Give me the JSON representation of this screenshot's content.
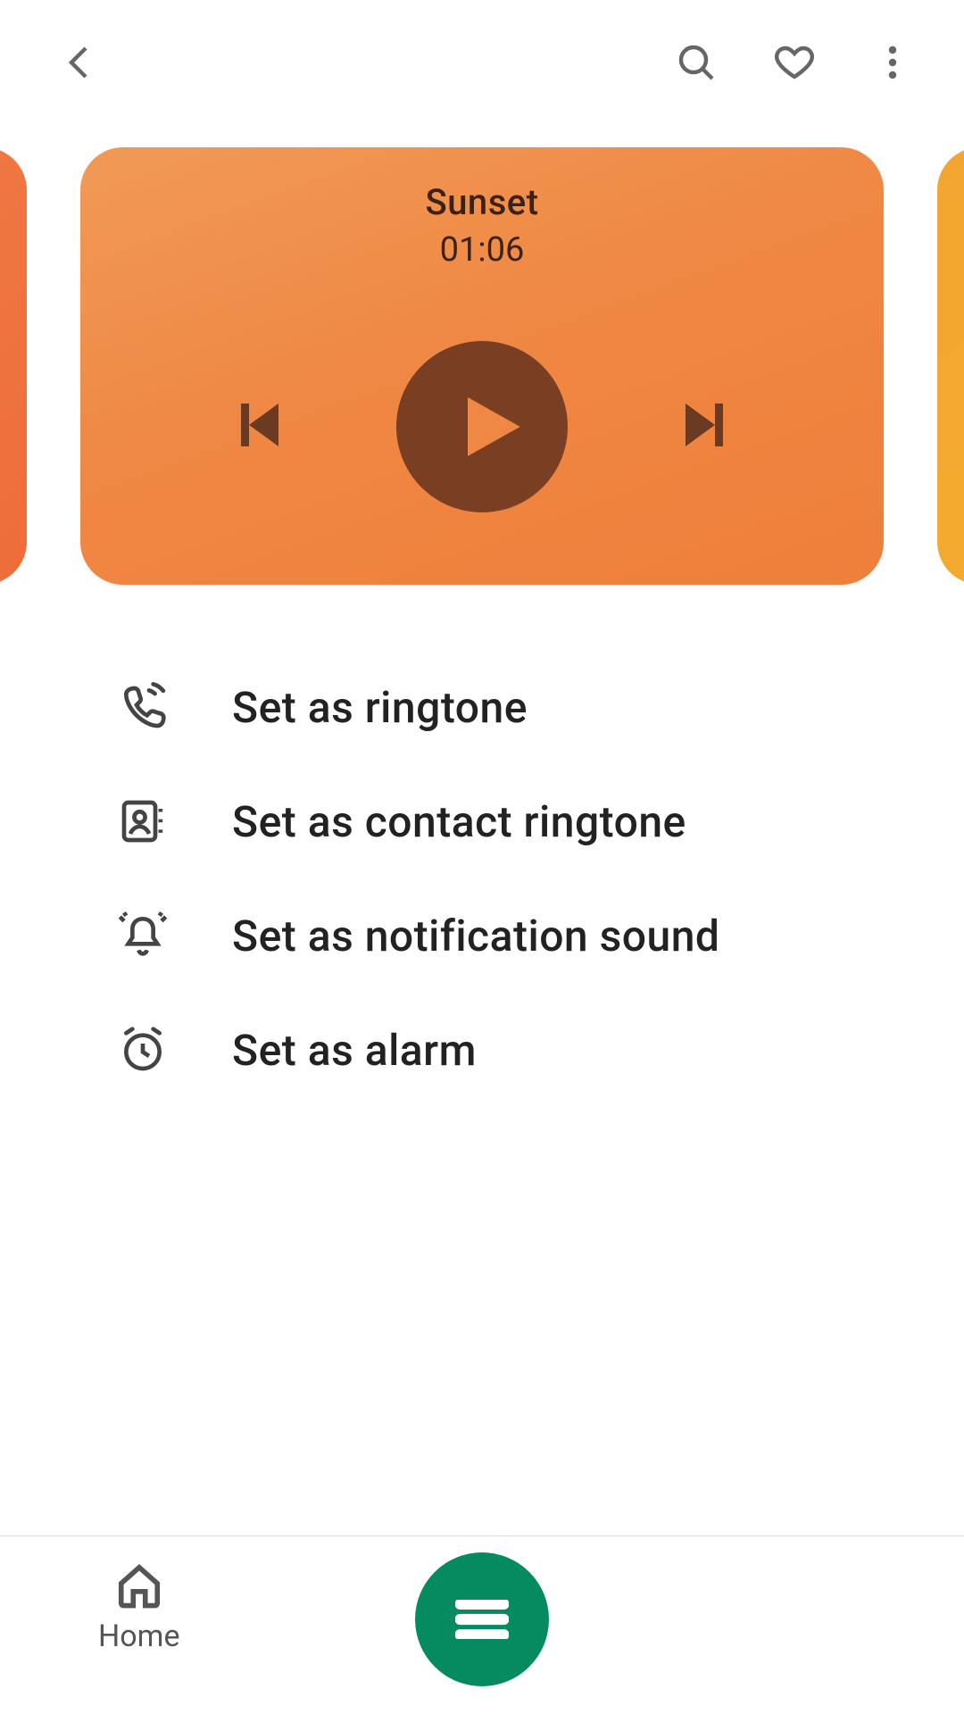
{
  "track": {
    "title": "Sunset",
    "duration": "01:06"
  },
  "options": [
    {
      "label": "Set as ringtone"
    },
    {
      "label": "Set as contact ringtone"
    },
    {
      "label": "Set as notification sound"
    },
    {
      "label": "Set as alarm"
    }
  ],
  "nav": {
    "home": "Home"
  }
}
